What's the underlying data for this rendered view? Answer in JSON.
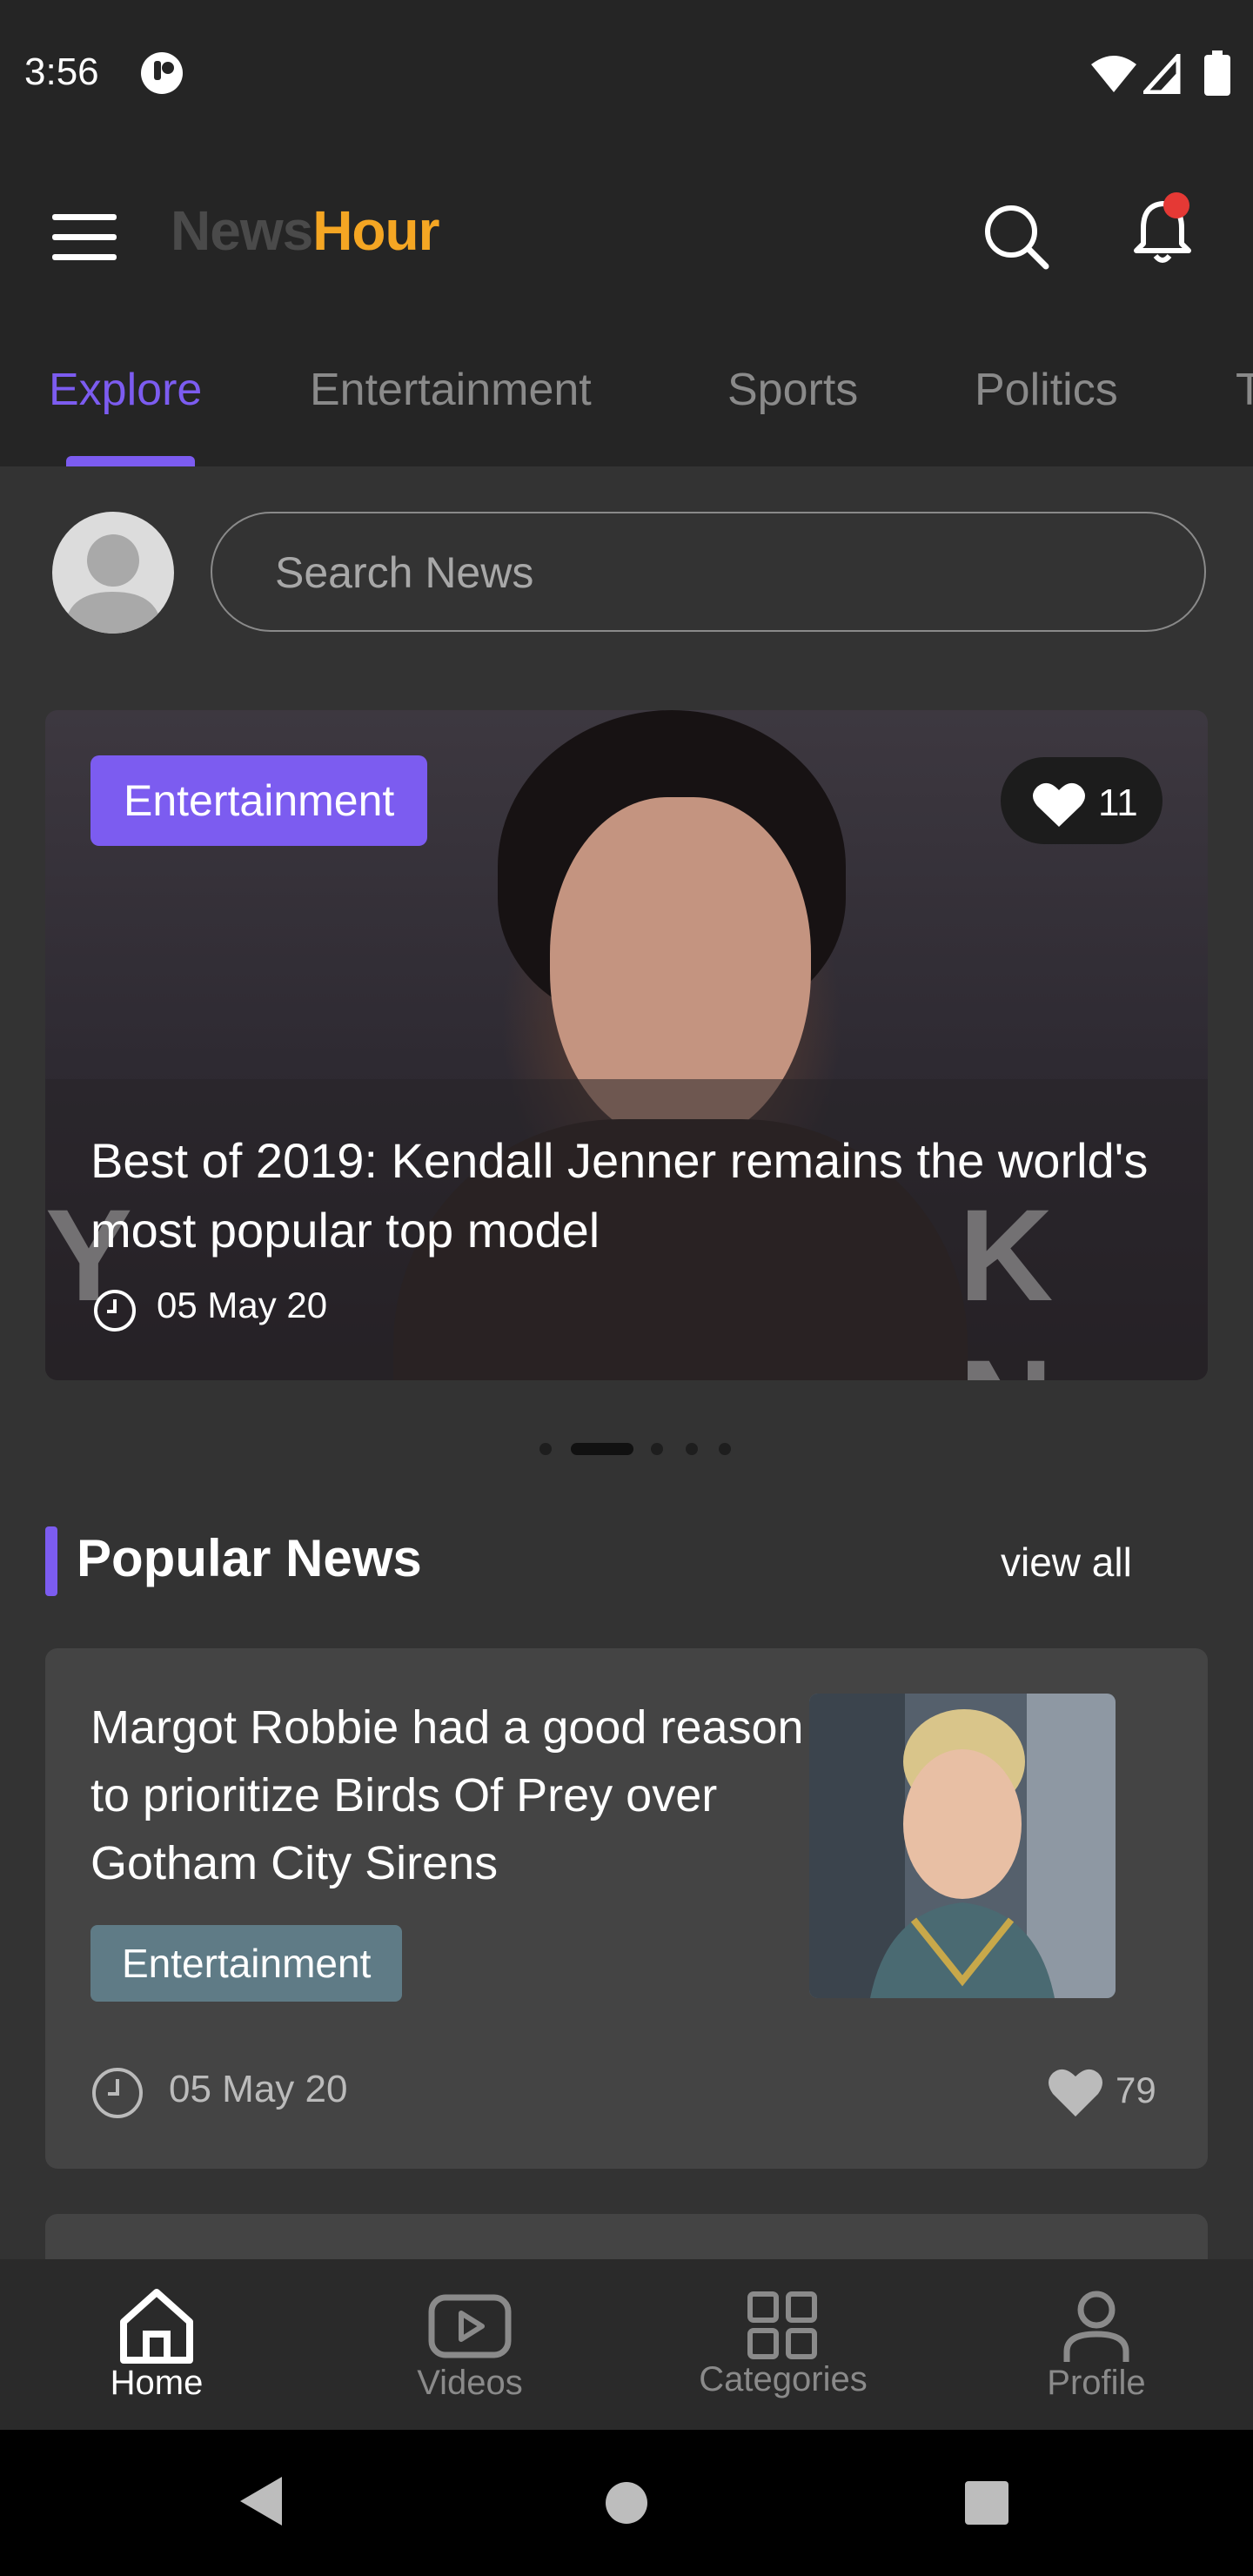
{
  "status_bar": {
    "time": "3:56"
  },
  "app_bar": {
    "brand_part1": "News",
    "brand_part2": "Hour"
  },
  "tabs": [
    {
      "label": "Explore",
      "active": true
    },
    {
      "label": "Entertainment",
      "active": false
    },
    {
      "label": "Sports",
      "active": false
    },
    {
      "label": "Politics",
      "active": false
    },
    {
      "label": "T",
      "active": false
    }
  ],
  "search": {
    "placeholder": "Search News"
  },
  "featured": {
    "category": "Entertainment",
    "likes": "11",
    "title": "Best of 2019: Kendall Jenner remains the world's most popular top model",
    "date": "05 May 20",
    "background_letters_right": "K N",
    "background_letters_left": "Y"
  },
  "carousel": {
    "page_count": 5,
    "active_index": 1
  },
  "popular": {
    "title": "Popular News",
    "view_all": "view all",
    "items": [
      {
        "title": "Margot Robbie had a good reason to prioritize Birds Of Prey over Gotham City Sirens",
        "category": "Entertainment",
        "date": "05 May 20",
        "likes": "79"
      }
    ]
  },
  "bottom_nav": [
    {
      "label": "Home",
      "icon": "home-icon",
      "active": true
    },
    {
      "label": "Videos",
      "icon": "video-icon",
      "active": false
    },
    {
      "label": "Categories",
      "icon": "grid-icon",
      "active": false
    },
    {
      "label": "Profile",
      "icon": "person-icon",
      "active": false
    }
  ],
  "colors": {
    "accent": "#7C5CF0",
    "brand_orange": "#F5A623",
    "notification_dot": "#E53935",
    "chip_gray": "#5F7B86"
  }
}
